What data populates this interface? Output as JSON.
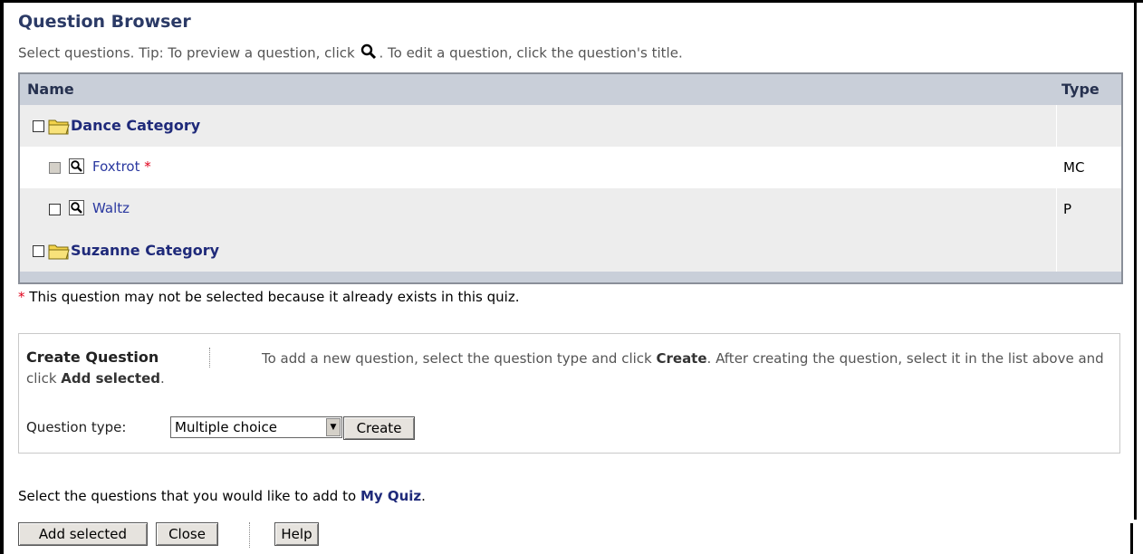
{
  "header": {
    "title": "Question Browser",
    "tip_before": "Select questions. Tip: To preview a question, click",
    "tip_after": ". To edit a question, click the question's title."
  },
  "table": {
    "columns": [
      "Name",
      "Type"
    ],
    "rows": [
      {
        "kind": "category",
        "label": "Dance Category",
        "type": ""
      },
      {
        "kind": "question",
        "label": "Foxtrot",
        "marker": "*",
        "type": "MC",
        "disabled": true
      },
      {
        "kind": "question",
        "label": "Waltz",
        "type": "P",
        "disabled": false
      },
      {
        "kind": "category",
        "label": "Suzanne Category",
        "type": ""
      }
    ]
  },
  "note": {
    "marker": "*",
    "text": "This question may not be selected because it already exists in this quiz."
  },
  "create": {
    "title": "Create Question",
    "desc_1": "To add a new question, select the question type and click ",
    "create_word": "Create",
    "desc_2": ". After creating the question, select it in the list above and click ",
    "add_word": "Add selected",
    "desc_3": ".",
    "type_label": "Question type:",
    "type_value": "Multiple choice",
    "create_button": "Create"
  },
  "footer": {
    "text_before": "Select the questions that you would like to add to ",
    "quiz_name": "My Quiz",
    "text_after": ".",
    "buttons": {
      "add": "Add selected",
      "close": "Close",
      "help": "Help"
    }
  },
  "colors": {
    "title": "#2b3a66",
    "category": "#1f2a7a",
    "link": "#2b39a0",
    "star": "#e0001b",
    "table_header": "#c9cfd9"
  }
}
